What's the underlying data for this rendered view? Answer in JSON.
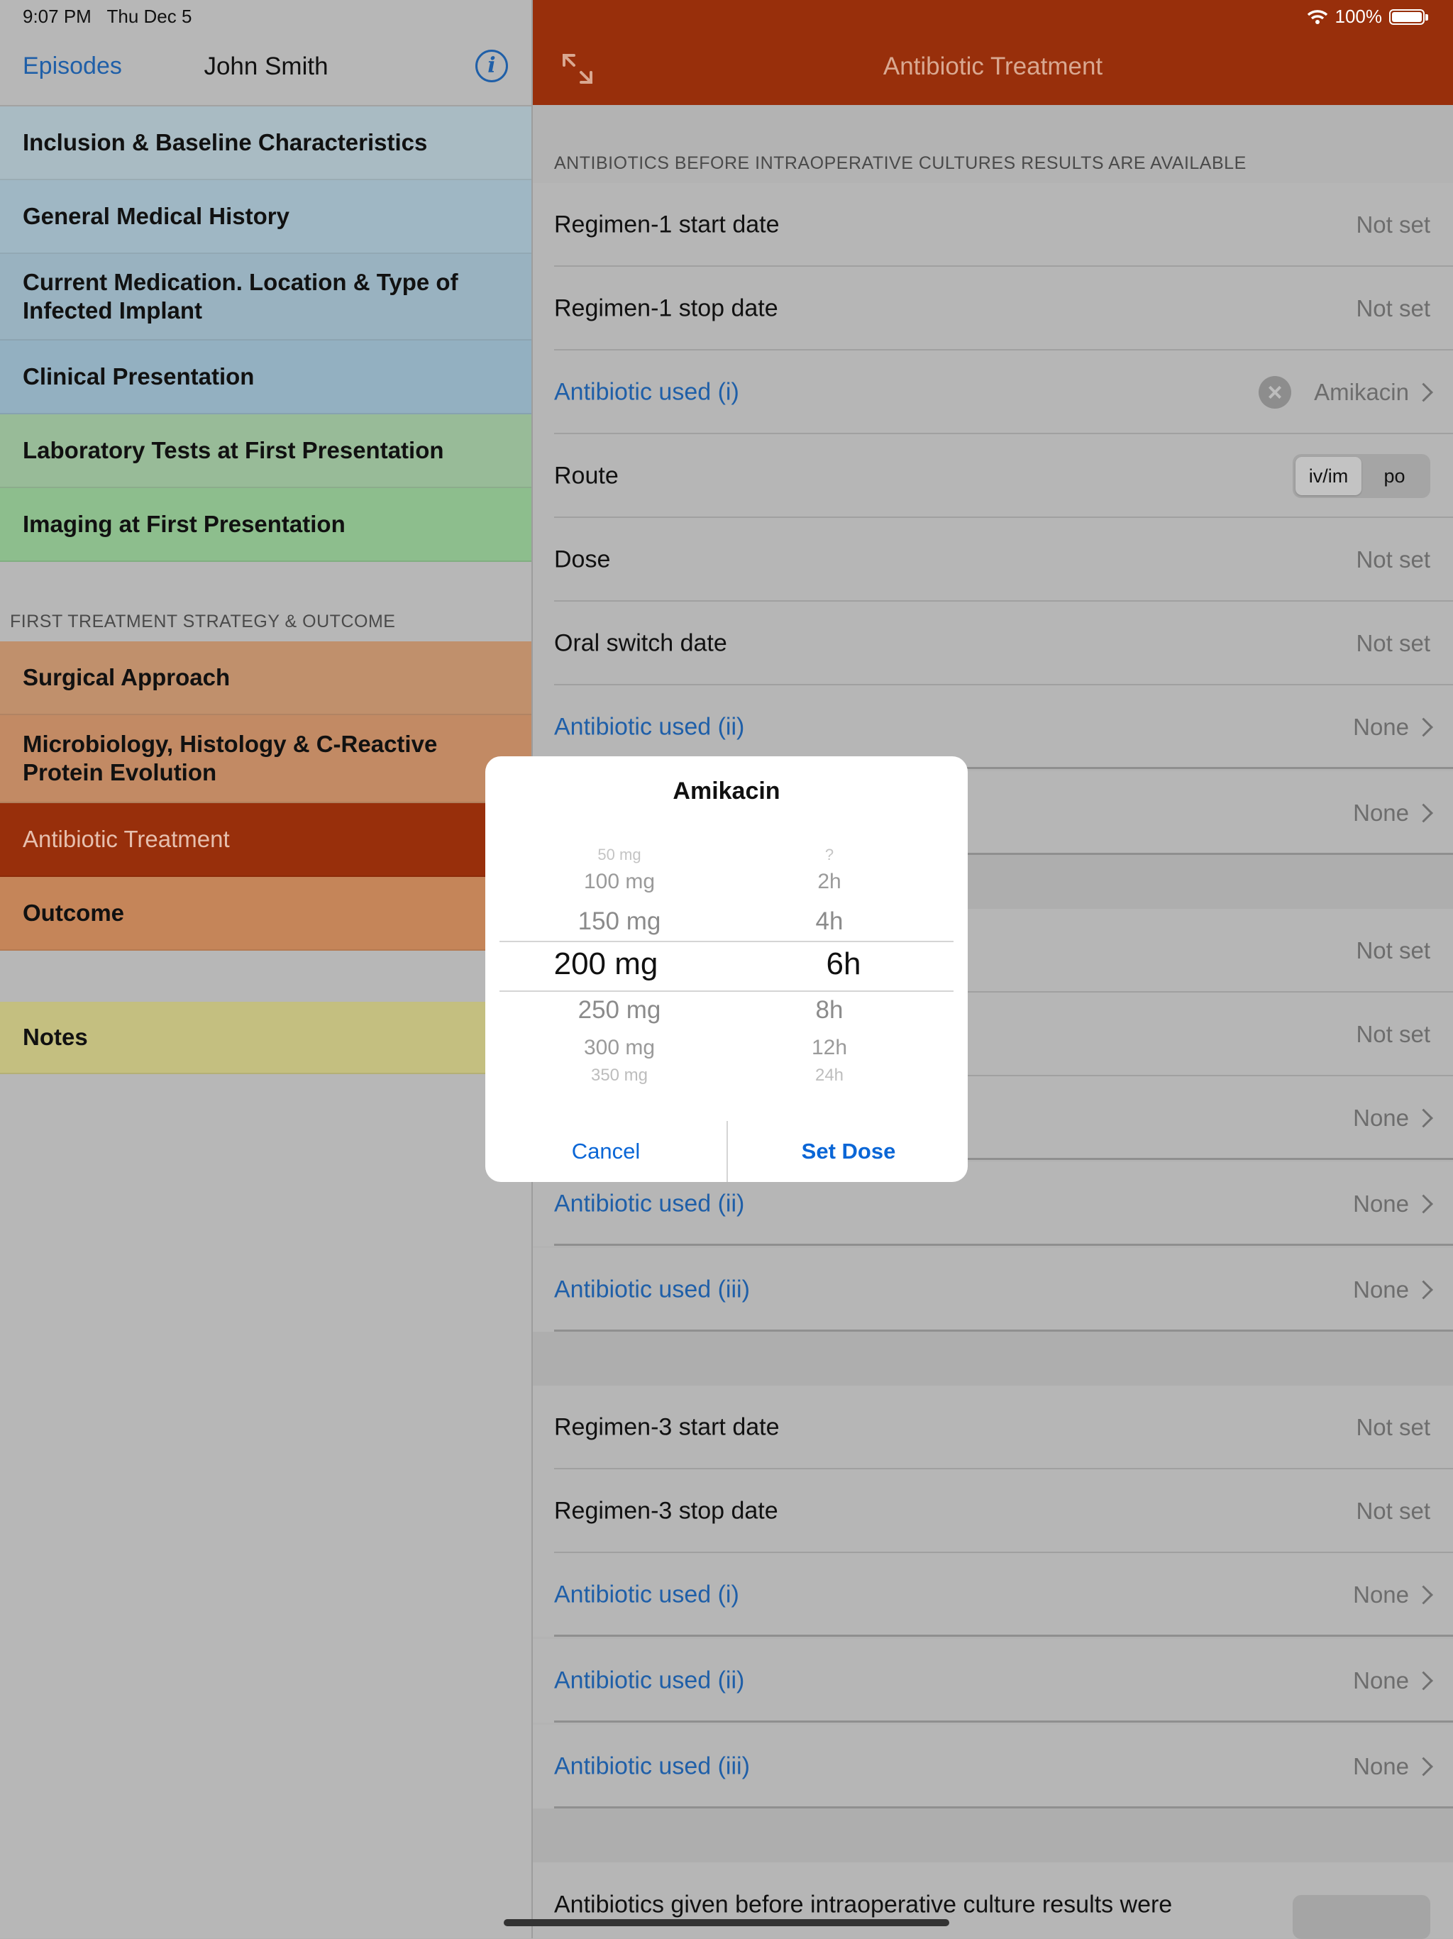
{
  "status_bar": {
    "time": "9:07 PM",
    "date": "Thu Dec 5",
    "battery": "100%"
  },
  "sidebar": {
    "back_label": "Episodes",
    "patient_name": "John Smith",
    "items": [
      {
        "label": "Inclusion & Baseline Characteristics",
        "color": "#a9bbc3"
      },
      {
        "label": "General Medical History",
        "color": "#9fb7c4"
      },
      {
        "label": "Current Medication. Location & Type of Infected Implant",
        "color": "#99b2c0"
      },
      {
        "label": "Clinical Presentation",
        "color": "#93b0c1"
      },
      {
        "label": "Laboratory Tests at First Presentation",
        "color": "#98bb98"
      },
      {
        "label": "Imaging at First Presentation",
        "color": "#8dbe8d"
      }
    ],
    "section_header": "FIRST TREATMENT STRATEGY & OUTCOME",
    "strategy_items": [
      {
        "label": "Surgical Approach",
        "color": "#c0906c"
      },
      {
        "label": "Microbiology, Histology & C-Reactive Protein Evolution",
        "color": "#c28a64"
      },
      {
        "label": "Antibiotic Treatment",
        "color": "#982f0b",
        "selected": true
      },
      {
        "label": "Outcome",
        "color": "#c58559"
      }
    ],
    "notes": {
      "label": "Notes",
      "color": "#c4bf80"
    }
  },
  "detail": {
    "title": "Antibiotic Treatment",
    "section_header": "ANTIBIOTICS BEFORE INTRAOPERATIVE CULTURES RESULTS ARE AVAILABLE",
    "regimen1": {
      "start_label": "Regimen-1 start date",
      "start_value": "Not set",
      "stop_label": "Regimen-1 stop date",
      "stop_value": "Not set",
      "ab1_label": "Antibiotic used (i)",
      "ab1_value": "Amikacin",
      "route_label": "Route",
      "route_options": [
        "iv/im",
        "po"
      ],
      "dose_label": "Dose",
      "dose_value": "Not set",
      "oral_label": "Oral switch date",
      "oral_value": "Not set",
      "ab2_label": "Antibiotic used (ii)",
      "ab2_value": "None",
      "ab3_value": "None"
    },
    "regimen2": {
      "start_value": "Not set",
      "stop_value": "Not set",
      "ab1_value": "None",
      "ab2_label": "Antibiotic used (ii)",
      "ab2_value": "None",
      "ab3_label": "Antibiotic used (iii)",
      "ab3_value": "None"
    },
    "regimen3": {
      "start_label": "Regimen-3 start date",
      "start_value": "Not set",
      "stop_label": "Regimen-3 stop date",
      "stop_value": "Not set",
      "ab1_label": "Antibiotic used (i)",
      "ab1_value": "None",
      "ab2_label": "Antibiotic used (ii)",
      "ab2_value": "None",
      "ab3_label": "Antibiotic used (iii)",
      "ab3_value": "None"
    },
    "footer_text": "Antibiotics given before intraoperative culture results were"
  },
  "dialog": {
    "title": "Amikacin",
    "dose_options": [
      "50 mg",
      "100 mg",
      "150 mg",
      "200 mg",
      "250 mg",
      "300 mg",
      "350 mg"
    ],
    "dose_selected": "200 mg",
    "interval_options": [
      "?",
      "2h",
      "4h",
      "6h",
      "8h",
      "12h",
      "24h"
    ],
    "interval_selected": "6h",
    "cancel_label": "Cancel",
    "confirm_label": "Set Dose"
  },
  "colors": {
    "accent": "#982f0b",
    "link": "#1f5fa8",
    "button": "#0a66d6"
  }
}
